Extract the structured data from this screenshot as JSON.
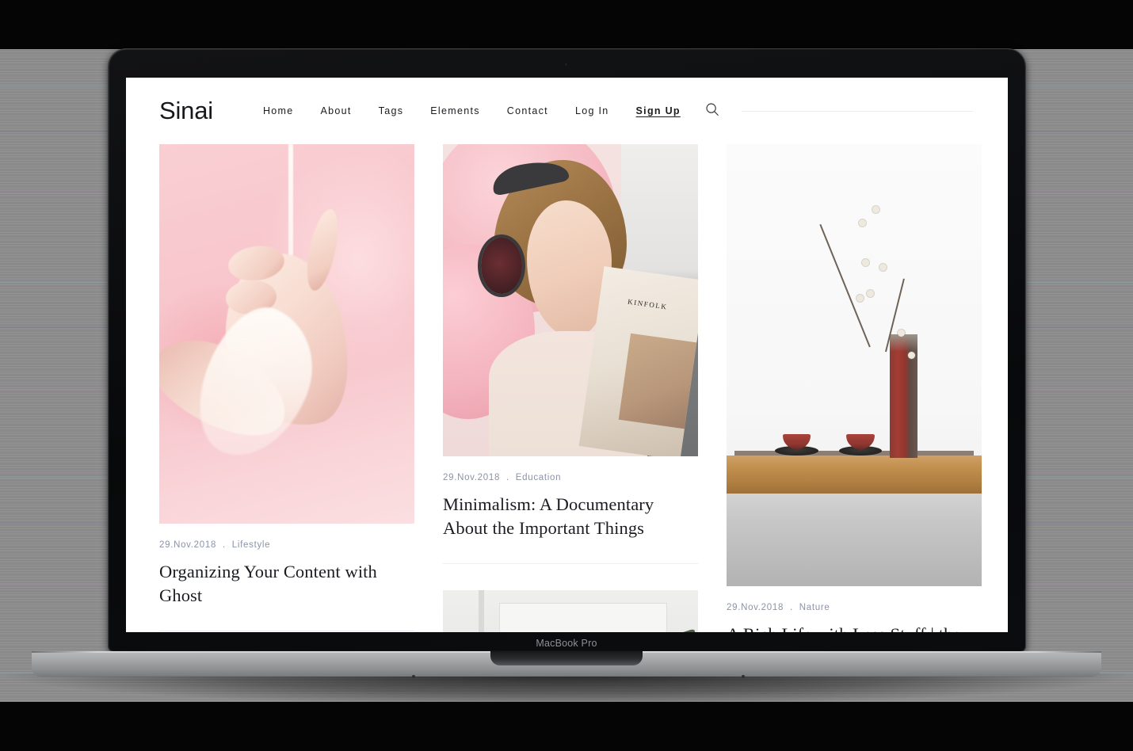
{
  "device": {
    "model_label": "MacBook Pro"
  },
  "site": {
    "brand": "Sinai",
    "nav": [
      {
        "label": "Home",
        "name": "nav-home"
      },
      {
        "label": "About",
        "name": "nav-about"
      },
      {
        "label": "Tags",
        "name": "nav-tags"
      },
      {
        "label": "Elements",
        "name": "nav-elements"
      },
      {
        "label": "Contact",
        "name": "nav-contact"
      },
      {
        "label": "Log In",
        "name": "nav-login"
      },
      {
        "label": "Sign Up",
        "name": "nav-signup"
      }
    ],
    "search": {
      "icon": "search-icon",
      "placeholder": ""
    },
    "columns": [
      {
        "cards": [
          {
            "image": "hand-with-milk-on-pink",
            "date": "29.Nov.2018",
            "separator": ".",
            "tag": "Lifestyle",
            "title": "Organizing Your Content with Ghost"
          },
          {
            "image": "teal-color-block",
            "date": "",
            "separator": "",
            "tag": "",
            "title": ""
          }
        ]
      },
      {
        "cards": [
          {
            "image": "woman-with-headphones-reading-kinfolk",
            "date": "29.Nov.2018",
            "separator": ".",
            "tag": "Education",
            "title": "Minimalism: A Documentary About the Important Things"
          },
          {
            "image": "white-window-interior",
            "date": "",
            "separator": "",
            "tag": "",
            "title": ""
          }
        ]
      },
      {
        "cards": [
          {
            "image": "red-vase-with-branch-on-wooden-table",
            "date": "29.Nov.2018",
            "separator": ".",
            "tag": "Nature",
            "title": "A Rich Life with Less Stuff | the"
          }
        ]
      }
    ],
    "book_cover_text": "KINFOLK"
  },
  "colors": {
    "meta_text": "#8b93a7",
    "title_text": "#1a1c21",
    "nav_text": "#1a1c1f",
    "divider": "#edeff3",
    "teal_block": "#a4ccd1",
    "page_background": "#ffffff"
  }
}
